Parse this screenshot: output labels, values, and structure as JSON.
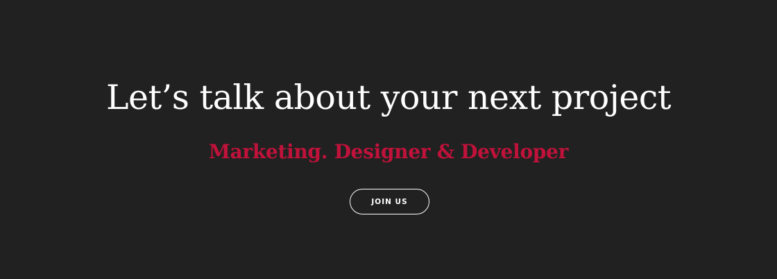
{
  "cta": {
    "headline": "Let’s talk about your next project",
    "subtitle": "Marketing. Designer & Developer",
    "button_label": "JOIN US"
  },
  "colors": {
    "background": "#212121",
    "headline": "#ffffff",
    "accent": "#c0123a",
    "button_border": "#ffffff"
  }
}
